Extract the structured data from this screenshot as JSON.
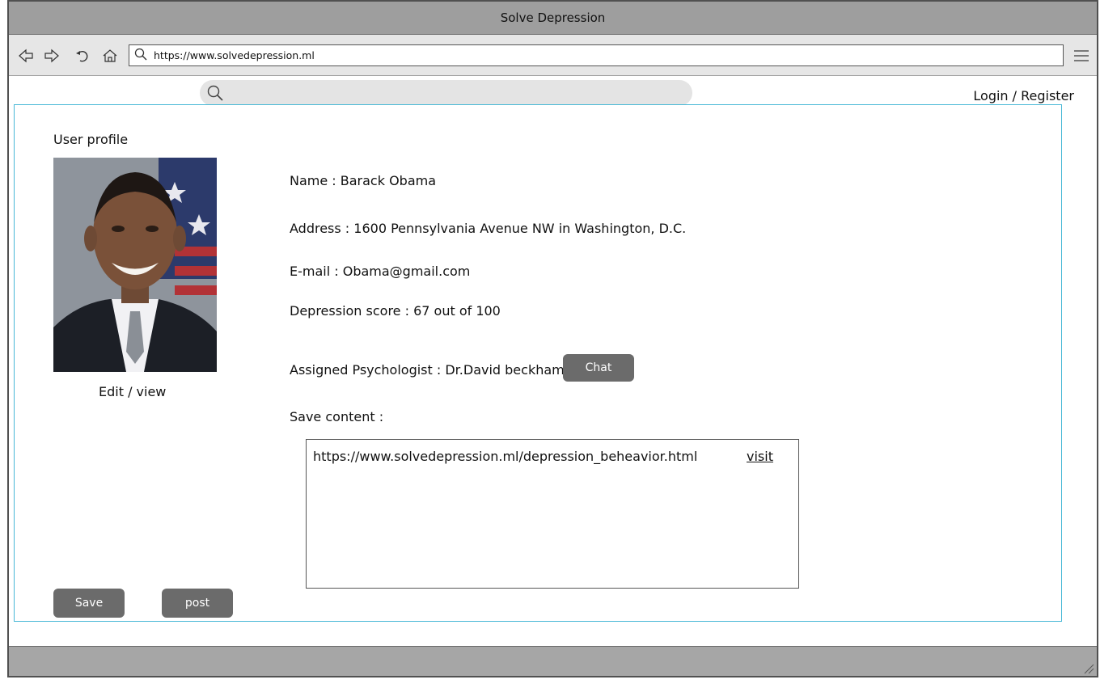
{
  "window": {
    "title": "Solve Depression"
  },
  "browser": {
    "url": "https://www.solvedepression.ml",
    "icons": [
      "back-icon",
      "forward-icon",
      "reload-icon",
      "home-icon",
      "search-icon",
      "menu-icon"
    ]
  },
  "header": {
    "login_label": "Login / Register"
  },
  "profile": {
    "section_label": "User profile",
    "edit_label": "Edit / view",
    "name": "Name : Barack Obama",
    "address": "Address :  1600 Pennsylvania Avenue NW in Washington, D.C.",
    "email": "E-mail  :  Obama@gmail.com",
    "score": "Depression score :  67 out of 100",
    "psychologist": "Assigned Psychologist : Dr.David beckham",
    "chat_label": "Chat",
    "save_content_label": "Save content :",
    "saved_items": [
      {
        "url": "https://www.solvedepression.ml/depression_beheavior.html",
        "link_label": "visit"
      }
    ]
  },
  "actions": {
    "save_label": "Save",
    "post_label": "post"
  },
  "colors": {
    "frame_border": "#47b8d6",
    "button_bg": "#6b6b6b",
    "titlebar_bg": "#9e9e9e"
  }
}
